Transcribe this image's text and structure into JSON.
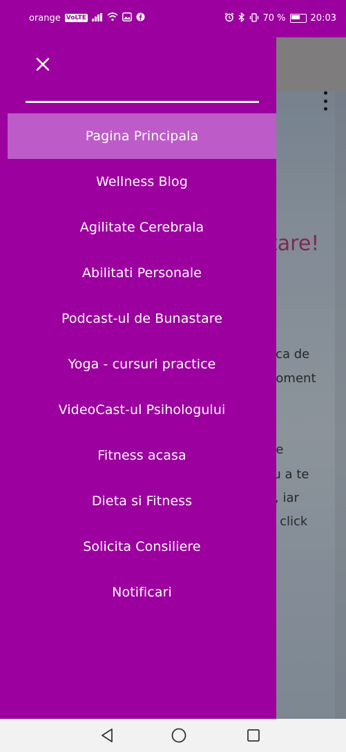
{
  "status_bar": {
    "carrier": "orange",
    "volte": "VoLTE",
    "battery_percent": "70 %",
    "battery_level": 0.7,
    "time": "20:03"
  },
  "drawer": {
    "close_icon": "close-icon",
    "menu_items": [
      {
        "label": "Pagina Principala",
        "active": true
      },
      {
        "label": "Wellness Blog",
        "active": false
      },
      {
        "label": "Agilitate Cerebrala",
        "active": false
      },
      {
        "label": "Abilitati Personale",
        "active": false
      },
      {
        "label": "Podcast-ul de Bunastare",
        "active": false
      },
      {
        "label": "Yoga - cursuri practice",
        "active": false
      },
      {
        "label": "VideoCast-ul Psihologului",
        "active": false
      },
      {
        "label": "Fitness acasa",
        "active": false
      },
      {
        "label": "Dieta si Fitness",
        "active": false
      },
      {
        "label": "Solicita Consiliere",
        "active": false
      },
      {
        "label": "Notificari",
        "active": false
      }
    ]
  },
  "background_content": {
    "heading_fragment": "tare!",
    "text_fragments": [
      "eca de",
      "noment",
      "de",
      "ru a te",
      "ii, iar",
      "n click"
    ]
  },
  "colors": {
    "drawer": "#9c009f",
    "active_item": "#bd5bc8",
    "heading_accent": "#b73a79"
  }
}
